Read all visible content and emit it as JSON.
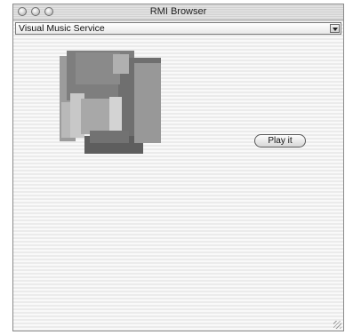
{
  "window": {
    "title": "RMI Browser"
  },
  "service_select": {
    "selected": "Visual Music Service"
  },
  "play_button": {
    "label": "Play it"
  },
  "icons": {
    "traffic_lights": [
      "close-icon",
      "minimize-icon",
      "zoom-icon"
    ],
    "dropdown": "chevron-down-icon",
    "resize": "resize-grip-icon"
  },
  "visual_blocks": {
    "colors": [
      "#9c9c9c",
      "#7e7e7e",
      "#b9b9b9",
      "#6f6f6f",
      "#c8c8c8",
      "#8a8a8a",
      "#a8a8a8",
      "#d3d3d3",
      "#5e5e5e",
      "#989898",
      "#727272",
      "#b0b0b0"
    ]
  }
}
